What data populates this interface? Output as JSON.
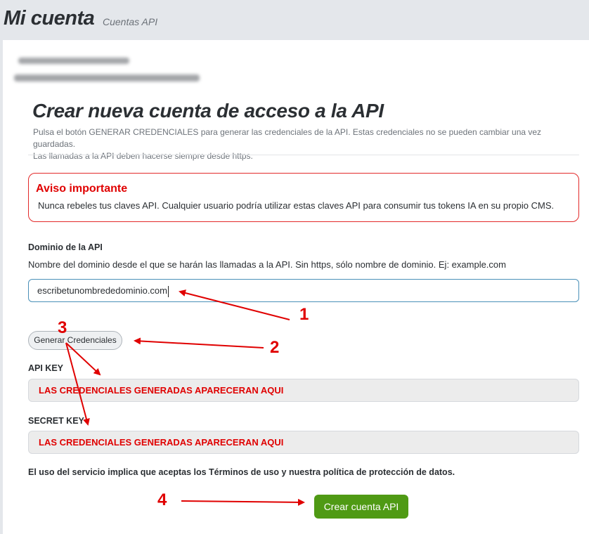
{
  "header": {
    "title": "Mi cuenta",
    "subtitle": "Cuentas API"
  },
  "form": {
    "heading": "Crear nueva cuenta de acceso a la API",
    "description_line1": "Pulsa el botón GENERAR CREDENCIALES para generar las credenciales de la API. Estas credenciales no se pueden cambiar una vez guardadas.",
    "description_line2": "Las llamadas a la API deben hacerse siempre desde https.",
    "alert": {
      "title": "Aviso importante",
      "text": "Nunca rebeles tus claves API. Cualquier usuario podría utilizar estas claves API para consumir tus tokens IA en su propio CMS."
    },
    "domain": {
      "label": "Dominio de la API",
      "help": "Nombre del dominio desde el que se harán las llamadas a la API. Sin https, sólo nombre de dominio. Ej: example.com",
      "value": "escribetunombrededominio.com"
    },
    "generate_button": "Generar Credenciales",
    "api_key": {
      "label": "API KEY",
      "value": "LAS CREDENCIALES GENERADAS APARECERAN AQUI"
    },
    "secret_key": {
      "label": "SECRET KEY",
      "value": "LAS CREDENCIALES GENERADAS APARECERAN AQUI"
    },
    "terms": "El uso del servicio implica que aceptas los Términos de uso y nuestra política de protección de datos.",
    "submit_button": "Crear cuenta API"
  },
  "annotations": {
    "color": "#e00000",
    "step1": "1",
    "step2": "2",
    "step3": "3",
    "step4": "4"
  },
  "colors": {
    "accent_green": "#4f9a14",
    "alert_red": "#e32a2a",
    "input_border": "#4a90b8"
  }
}
